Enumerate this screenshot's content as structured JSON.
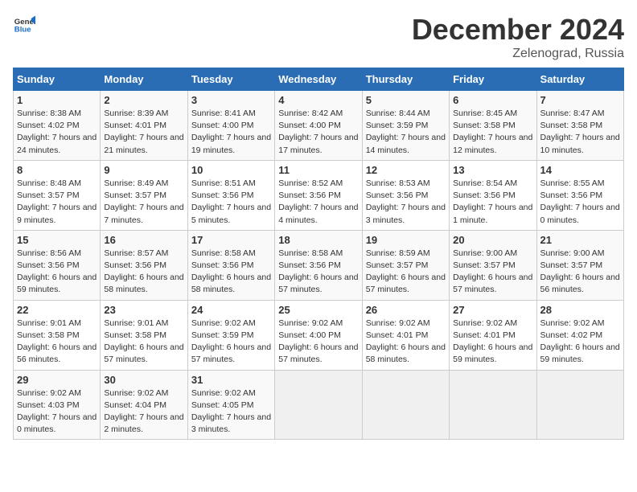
{
  "header": {
    "logo_general": "General",
    "logo_blue": "Blue",
    "month": "December 2024",
    "location": "Zelenograd, Russia"
  },
  "days_of_week": [
    "Sunday",
    "Monday",
    "Tuesday",
    "Wednesday",
    "Thursday",
    "Friday",
    "Saturday"
  ],
  "weeks": [
    [
      {
        "day": "1",
        "sunrise": "8:38 AM",
        "sunset": "4:02 PM",
        "daylight": "7 hours and 24 minutes."
      },
      {
        "day": "2",
        "sunrise": "8:39 AM",
        "sunset": "4:01 PM",
        "daylight": "7 hours and 21 minutes."
      },
      {
        "day": "3",
        "sunrise": "8:41 AM",
        "sunset": "4:00 PM",
        "daylight": "7 hours and 19 minutes."
      },
      {
        "day": "4",
        "sunrise": "8:42 AM",
        "sunset": "4:00 PM",
        "daylight": "7 hours and 17 minutes."
      },
      {
        "day": "5",
        "sunrise": "8:44 AM",
        "sunset": "3:59 PM",
        "daylight": "7 hours and 14 minutes."
      },
      {
        "day": "6",
        "sunrise": "8:45 AM",
        "sunset": "3:58 PM",
        "daylight": "7 hours and 12 minutes."
      },
      {
        "day": "7",
        "sunrise": "8:47 AM",
        "sunset": "3:58 PM",
        "daylight": "7 hours and 10 minutes."
      }
    ],
    [
      {
        "day": "8",
        "sunrise": "8:48 AM",
        "sunset": "3:57 PM",
        "daylight": "7 hours and 9 minutes."
      },
      {
        "day": "9",
        "sunrise": "8:49 AM",
        "sunset": "3:57 PM",
        "daylight": "7 hours and 7 minutes."
      },
      {
        "day": "10",
        "sunrise": "8:51 AM",
        "sunset": "3:56 PM",
        "daylight": "7 hours and 5 minutes."
      },
      {
        "day": "11",
        "sunrise": "8:52 AM",
        "sunset": "3:56 PM",
        "daylight": "7 hours and 4 minutes."
      },
      {
        "day": "12",
        "sunrise": "8:53 AM",
        "sunset": "3:56 PM",
        "daylight": "7 hours and 3 minutes."
      },
      {
        "day": "13",
        "sunrise": "8:54 AM",
        "sunset": "3:56 PM",
        "daylight": "7 hours and 1 minute."
      },
      {
        "day": "14",
        "sunrise": "8:55 AM",
        "sunset": "3:56 PM",
        "daylight": "7 hours and 0 minutes."
      }
    ],
    [
      {
        "day": "15",
        "sunrise": "8:56 AM",
        "sunset": "3:56 PM",
        "daylight": "6 hours and 59 minutes."
      },
      {
        "day": "16",
        "sunrise": "8:57 AM",
        "sunset": "3:56 PM",
        "daylight": "6 hours and 58 minutes."
      },
      {
        "day": "17",
        "sunrise": "8:58 AM",
        "sunset": "3:56 PM",
        "daylight": "6 hours and 58 minutes."
      },
      {
        "day": "18",
        "sunrise": "8:58 AM",
        "sunset": "3:56 PM",
        "daylight": "6 hours and 57 minutes."
      },
      {
        "day": "19",
        "sunrise": "8:59 AM",
        "sunset": "3:57 PM",
        "daylight": "6 hours and 57 minutes."
      },
      {
        "day": "20",
        "sunrise": "9:00 AM",
        "sunset": "3:57 PM",
        "daylight": "6 hours and 57 minutes."
      },
      {
        "day": "21",
        "sunrise": "9:00 AM",
        "sunset": "3:57 PM",
        "daylight": "6 hours and 56 minutes."
      }
    ],
    [
      {
        "day": "22",
        "sunrise": "9:01 AM",
        "sunset": "3:58 PM",
        "daylight": "6 hours and 56 minutes."
      },
      {
        "day": "23",
        "sunrise": "9:01 AM",
        "sunset": "3:58 PM",
        "daylight": "6 hours and 57 minutes."
      },
      {
        "day": "24",
        "sunrise": "9:02 AM",
        "sunset": "3:59 PM",
        "daylight": "6 hours and 57 minutes."
      },
      {
        "day": "25",
        "sunrise": "9:02 AM",
        "sunset": "4:00 PM",
        "daylight": "6 hours and 57 minutes."
      },
      {
        "day": "26",
        "sunrise": "9:02 AM",
        "sunset": "4:01 PM",
        "daylight": "6 hours and 58 minutes."
      },
      {
        "day": "27",
        "sunrise": "9:02 AM",
        "sunset": "4:01 PM",
        "daylight": "6 hours and 59 minutes."
      },
      {
        "day": "28",
        "sunrise": "9:02 AM",
        "sunset": "4:02 PM",
        "daylight": "6 hours and 59 minutes."
      }
    ],
    [
      {
        "day": "29",
        "sunrise": "9:02 AM",
        "sunset": "4:03 PM",
        "daylight": "7 hours and 0 minutes."
      },
      {
        "day": "30",
        "sunrise": "9:02 AM",
        "sunset": "4:04 PM",
        "daylight": "7 hours and 2 minutes."
      },
      {
        "day": "31",
        "sunrise": "9:02 AM",
        "sunset": "4:05 PM",
        "daylight": "7 hours and 3 minutes."
      },
      null,
      null,
      null,
      null
    ]
  ]
}
